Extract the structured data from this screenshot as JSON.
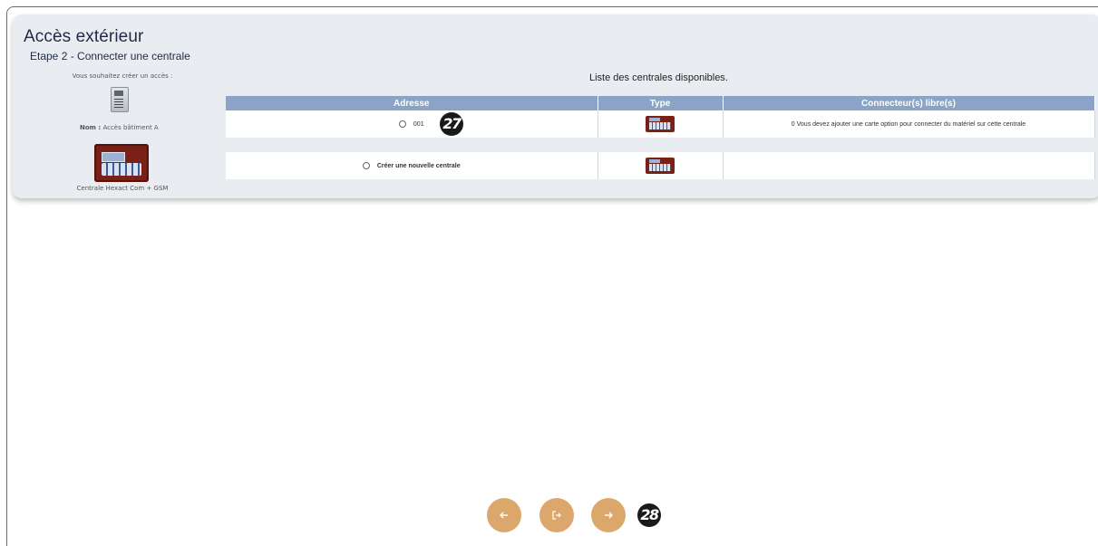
{
  "header": {
    "title": "Accès extérieur",
    "subtitle": "Etape 2 - Connecter une centrale"
  },
  "left_panel": {
    "prompt": "Vous souhaitez créer un accès :",
    "name_label": "Nom :",
    "name_value": "Accès bâtiment A",
    "central_caption": "Centrale Hexact Com + GSM"
  },
  "table": {
    "title": "Liste des centrales disponibles.",
    "headers": [
      "Adresse",
      "Type",
      "Connecteur(s) libre(s)"
    ],
    "rows": [
      {
        "address": "001",
        "connectors": "0 Vous devez ajouter une carte option pour connecter du matériel sur cette centrale"
      },
      {
        "address": "Créer une nouvelle centrale",
        "connectors": ""
      }
    ]
  },
  "annotations": [
    "27",
    "28"
  ],
  "nav": {
    "back_icon": "arrow-left-icon",
    "exit_icon": "exit-icon",
    "next_icon": "arrow-right-icon",
    "button_color": "#dca76b"
  },
  "colors": {
    "header_bg": "#8aa3c6",
    "card_bg": "#e9edf2",
    "title_color": "#1f2a44"
  }
}
